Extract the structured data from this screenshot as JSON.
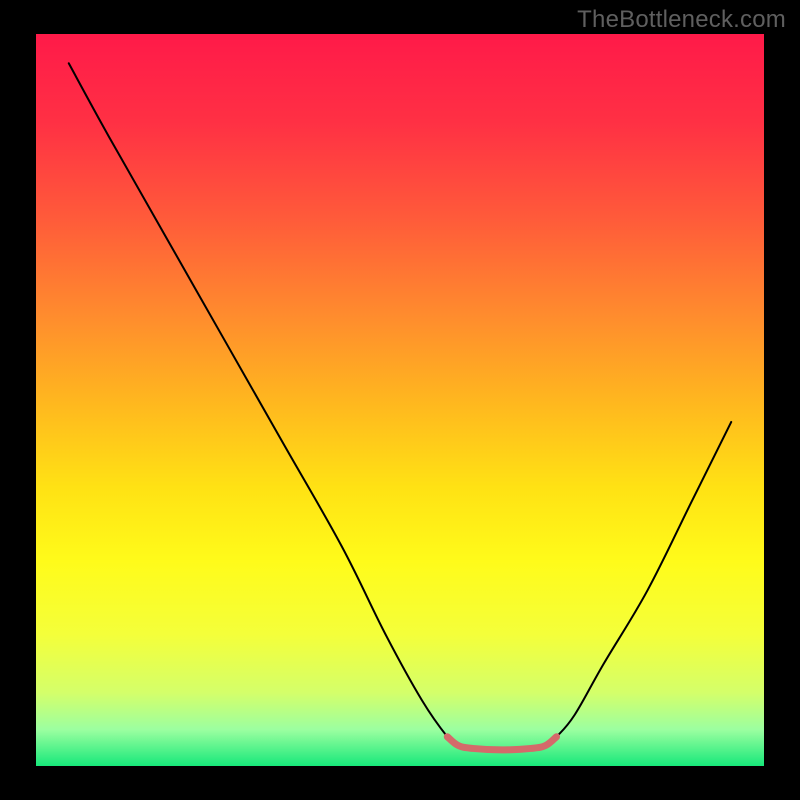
{
  "watermark": "TheBottleneck.com",
  "chart_data": {
    "type": "line",
    "title": "",
    "xlabel": "",
    "ylabel": "",
    "xlim": [
      0,
      100
    ],
    "ylim": [
      0,
      100
    ],
    "background_gradient": {
      "stops": [
        {
          "offset": 0.0,
          "color": "#ff1a49"
        },
        {
          "offset": 0.12,
          "color": "#ff3044"
        },
        {
          "offset": 0.25,
          "color": "#ff5a3a"
        },
        {
          "offset": 0.38,
          "color": "#ff8a2e"
        },
        {
          "offset": 0.5,
          "color": "#ffb61f"
        },
        {
          "offset": 0.62,
          "color": "#ffe214"
        },
        {
          "offset": 0.72,
          "color": "#fffb1a"
        },
        {
          "offset": 0.82,
          "color": "#f4ff3a"
        },
        {
          "offset": 0.9,
          "color": "#d4ff6a"
        },
        {
          "offset": 0.95,
          "color": "#9cffa0"
        },
        {
          "offset": 1.0,
          "color": "#17e87a"
        }
      ]
    },
    "series": [
      {
        "name": "bottleneck-curve",
        "stroke": "#000000",
        "stroke_width": 2,
        "points_xy": [
          [
            4.5,
            96.0
          ],
          [
            10.0,
            86.0
          ],
          [
            18.0,
            72.0
          ],
          [
            26.0,
            58.0
          ],
          [
            34.0,
            44.0
          ],
          [
            42.0,
            30.0
          ],
          [
            48.0,
            18.0
          ],
          [
            53.0,
            9.0
          ],
          [
            56.5,
            4.0
          ],
          [
            58.0,
            2.8
          ],
          [
            60.0,
            2.4
          ],
          [
            64.0,
            2.2
          ],
          [
            68.0,
            2.4
          ],
          [
            70.0,
            2.8
          ],
          [
            71.5,
            4.0
          ],
          [
            74.0,
            7.0
          ],
          [
            78.0,
            14.0
          ],
          [
            84.0,
            24.0
          ],
          [
            90.0,
            36.0
          ],
          [
            95.5,
            47.0
          ]
        ]
      },
      {
        "name": "optimal-band",
        "stroke": "#d46a6a",
        "stroke_width": 7,
        "points_xy": [
          [
            56.5,
            4.0
          ],
          [
            58.0,
            2.8
          ],
          [
            60.0,
            2.4
          ],
          [
            64.0,
            2.2
          ],
          [
            68.0,
            2.4
          ],
          [
            70.0,
            2.8
          ],
          [
            71.5,
            4.0
          ]
        ]
      }
    ]
  }
}
